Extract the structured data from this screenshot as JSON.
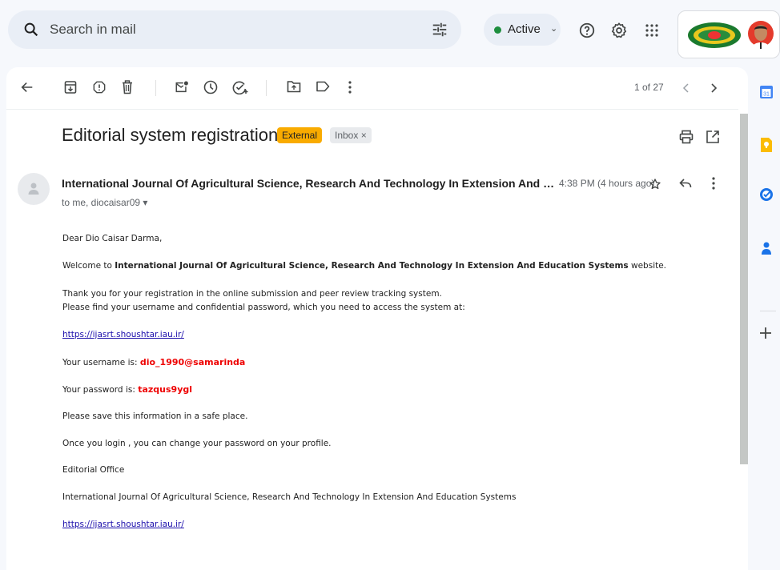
{
  "search": {
    "placeholder": "Search in mail"
  },
  "status": {
    "label": "Active",
    "color": "#1e8e3e"
  },
  "toolbar": {
    "pager": "1 of 27"
  },
  "message": {
    "subject": "Editorial system registration",
    "labels": {
      "external": "External",
      "inbox": "Inbox ×"
    },
    "sender": "International Journal Of Agricultural Science, Research And Technology In Extension And Education Systems",
    "time": "4:38 PM (4 hours ago)",
    "recipients": "to me, diocaisar09 ▾"
  },
  "body": {
    "greeting": "Dear Dio Caisar Darma,",
    "welcome_pre": "Welcome to ",
    "welcome_journal": "International Journal Of Agricultural Science, Research And Technology In Extension And Education Systems",
    "welcome_post": " website.",
    "thanks": "Thank you for your registration in the online submission and peer review tracking system.",
    "find": "Please find your username and confidential password, which you need to access the system at:",
    "link": "https://ijasrt.shoushtar.iau.ir/",
    "username_label": "Your username is: ",
    "username": "dio_1990@samarinda",
    "password_label": "Your password is: ",
    "password": "tazqus9ygl",
    "save": "Please save this information in a safe place.",
    "change": "Once you login , you can change your password on your profile.",
    "office": "Editorial Office",
    "journal": "International Journal Of Agricultural Science, Research And Technology In Extension And Education Systems",
    "link2": "https://ijasrt.shoushtar.iau.ir/"
  },
  "rail": {
    "calendar_day": "31"
  },
  "colors": {
    "external": "#f9ab00",
    "link": "#1a0dab",
    "credential": "#ee0000"
  }
}
